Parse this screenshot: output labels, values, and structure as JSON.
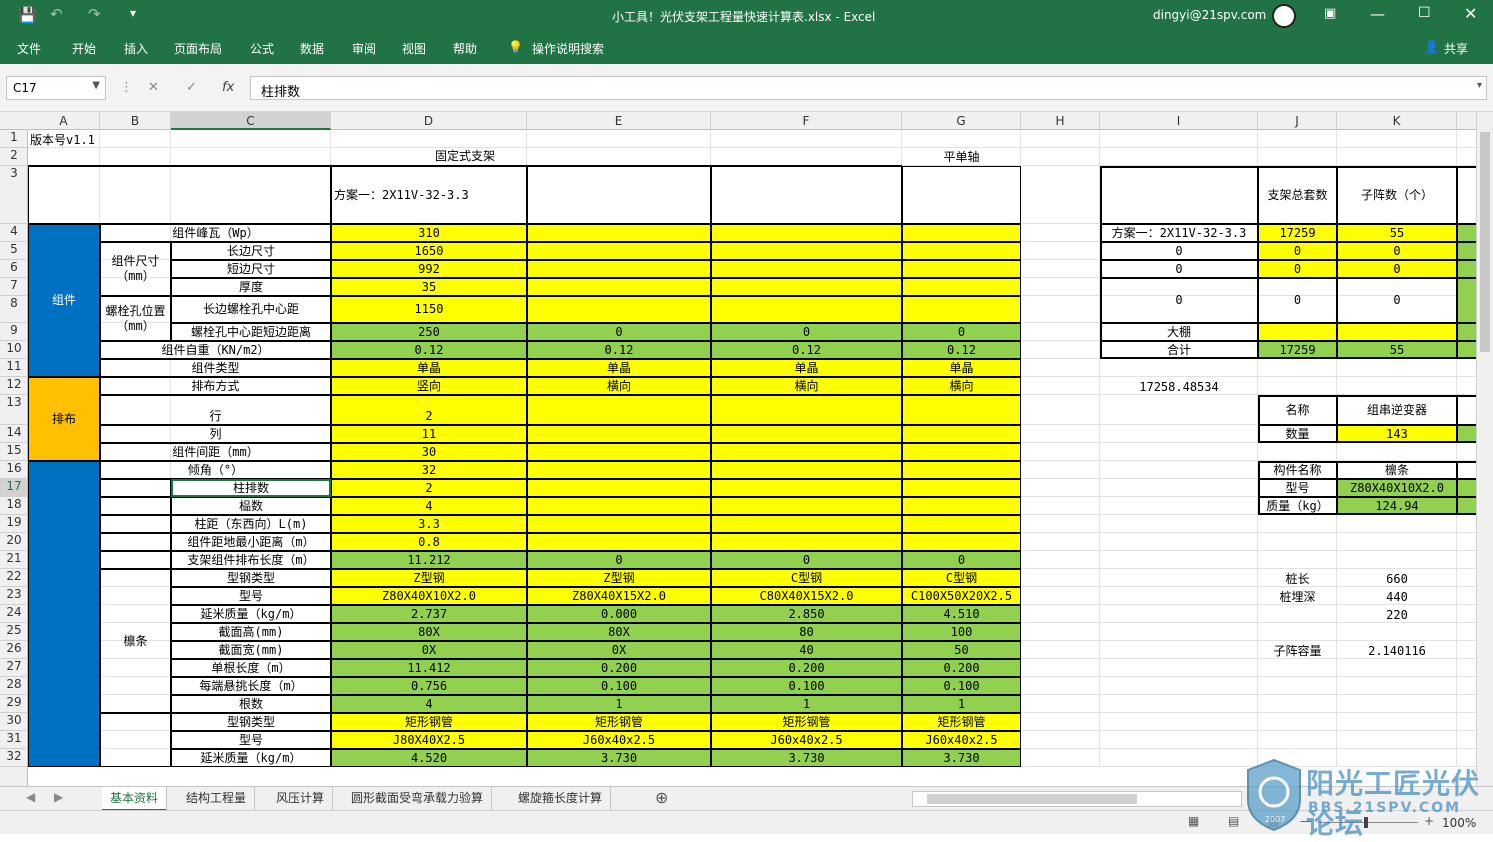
{
  "title": "小工具！光伏支架工程量快速计算表.xlsx  -  Excel",
  "user": "dingyi@21spv.com",
  "share": "共享",
  "menu": [
    "文件",
    "开始",
    "插入",
    "页面布局",
    "公式",
    "数据",
    "审阅",
    "视图",
    "帮助",
    "操作说明搜索"
  ],
  "namebox": "C17",
  "formula": "柱排数",
  "columns": [
    "A",
    "B",
    "C",
    "D",
    "E",
    "F",
    "G",
    "H",
    "I",
    "J",
    "K"
  ],
  "rows": [
    "1",
    "2",
    "3",
    "4",
    "5",
    "6",
    "7",
    "8",
    "9",
    "10",
    "11",
    "12",
    "13",
    "14",
    "15",
    "16",
    "17",
    "18",
    "19",
    "20",
    "21",
    "22",
    "23",
    "24",
    "25",
    "26",
    "27",
    "28",
    "29",
    "30",
    "31",
    "32"
  ],
  "cells": {
    "a1": "版本号v1.1",
    "c2": "固定式支架",
    "g2": "平单轴",
    "d3": "方案一：2X11V-32-3.3",
    "sec_module": "组件",
    "sec_layout": "排布",
    "sec_purlin": "檩条",
    "c4": "组件峰瓦（Wp）",
    "b5": "组件尺寸（mm）",
    "c5": "长边尺寸",
    "c6": "短边尺寸",
    "c7": "厚度",
    "b8": "螺栓孔位置（mm）",
    "c8": "长边螺栓孔中心距",
    "c9": "螺栓孔中心距短边距离",
    "c10": "组件自重（KN/m2）",
    "c11": "组件类型",
    "c12": "排布方式",
    "c13": "行",
    "c14": "列",
    "c15": "组件间距（mm）",
    "c16": "倾角（°）",
    "c17": "柱排数",
    "c18": "榀数",
    "c19": "柱距（东西向）L(m)",
    "c20": "组件距地最小距离（m）",
    "c21": "支架组件排布长度（m）",
    "c22": "型钢类型",
    "c23": "型号",
    "c24": "延米质量（kg/m）",
    "c25": "截面高(mm)",
    "c26": "截面宽(mm)",
    "c27": "单根长度（m）",
    "c28": "每端悬挑长度（m）",
    "c29": "根数",
    "c30": "型钢类型",
    "c31": "型号",
    "c32": "延米质量（kg/m）",
    "d4": "310",
    "d5": "1650",
    "d6": "992",
    "d7": "35",
    "d8": "1150",
    "d9": "250",
    "e9": "0",
    "f9": "0",
    "g9": "0",
    "d10": "0.12",
    "e10": "0.12",
    "f10": "0.12",
    "g10": "0.12",
    "d11": "单晶",
    "e11": "单晶",
    "f11": "单晶",
    "g11": "单晶",
    "d12": "竖向",
    "e12": "横向",
    "f12": "横向",
    "g12": "横向",
    "d13": "2",
    "d14": "11",
    "d15": "30",
    "d16": "32",
    "d17": "2",
    "d18": "4",
    "d19": "3.3",
    "d20": "0.8",
    "d21": "11.212",
    "e21": "0",
    "f21": "0",
    "g21": "0",
    "d22": "Z型钢",
    "e22": "Z型钢",
    "f22": "C型钢",
    "g22": "C型钢",
    "d23": "Z80X40X10X2.0",
    "e23": "Z80X40X15X2.0",
    "f23": "C80X40X15X2.0",
    "g23": "C100X50X20X2.5",
    "d24": "2.737",
    "e24": "0.000",
    "f24": "2.850",
    "g24": "4.510",
    "d25": "80X",
    "e25": "80X",
    "f25": "80",
    "g25": "100",
    "d26": "0X",
    "e26": "0X",
    "f26": "40",
    "g26": "50",
    "d27": "11.412",
    "e27": "0.200",
    "f27": "0.200",
    "g27": "0.200",
    "d28": "0.756",
    "e28": "0.100",
    "f28": "0.100",
    "g28": "0.100",
    "d29": "4",
    "e29": "1",
    "f29": "1",
    "g29": "1",
    "d30": "矩形钢管",
    "e30": "矩形钢管",
    "f30": "矩形钢管",
    "g30": "矩形钢管",
    "d31": "J80X40X2.5",
    "e31": "J60x40x2.5",
    "f31": "J60x40x2.5",
    "g31": "J60x40x2.5",
    "d32": "4.520",
    "e32": "3.730",
    "f32": "3.730",
    "g32": "3.730",
    "j3": "支架总套数",
    "k3": "子阵数（个）",
    "i4": "方案一：2X11V-32-3.3",
    "j4": "17259",
    "k4": "55",
    "i5": "0",
    "j5": "0",
    "k5": "0",
    "i6": "0",
    "j6": "0",
    "k6": "0",
    "i8": "0",
    "j8": "0",
    "k8": "0",
    "i9": "大棚",
    "i10": "合计",
    "j10": "17259",
    "k10": "55",
    "i12": "17258.48534",
    "j13": "名称",
    "k13": "组串逆变器",
    "j14": "数量",
    "k14": "143",
    "j16": "构件名称",
    "k16": "檩条",
    "j17": "型号",
    "k17": "Z80X40X10X2.0",
    "j18": "质量（kg）",
    "k18": "124.94",
    "j22": "桩长",
    "k22": "660",
    "j23": "桩埋深",
    "k23": "440",
    "k24": "220",
    "j26": "子阵容量",
    "k26": "2.140116"
  },
  "sheets": [
    "基本资料",
    "结构工程量",
    "风压计算",
    "圆形截面受弯承载力验算",
    "螺旋箍长度计算"
  ],
  "zoom": "100%",
  "watermark": {
    "title": "阳光工匠光伏论坛",
    "url": "BBS.21SPV.COM",
    "year": "2007"
  }
}
